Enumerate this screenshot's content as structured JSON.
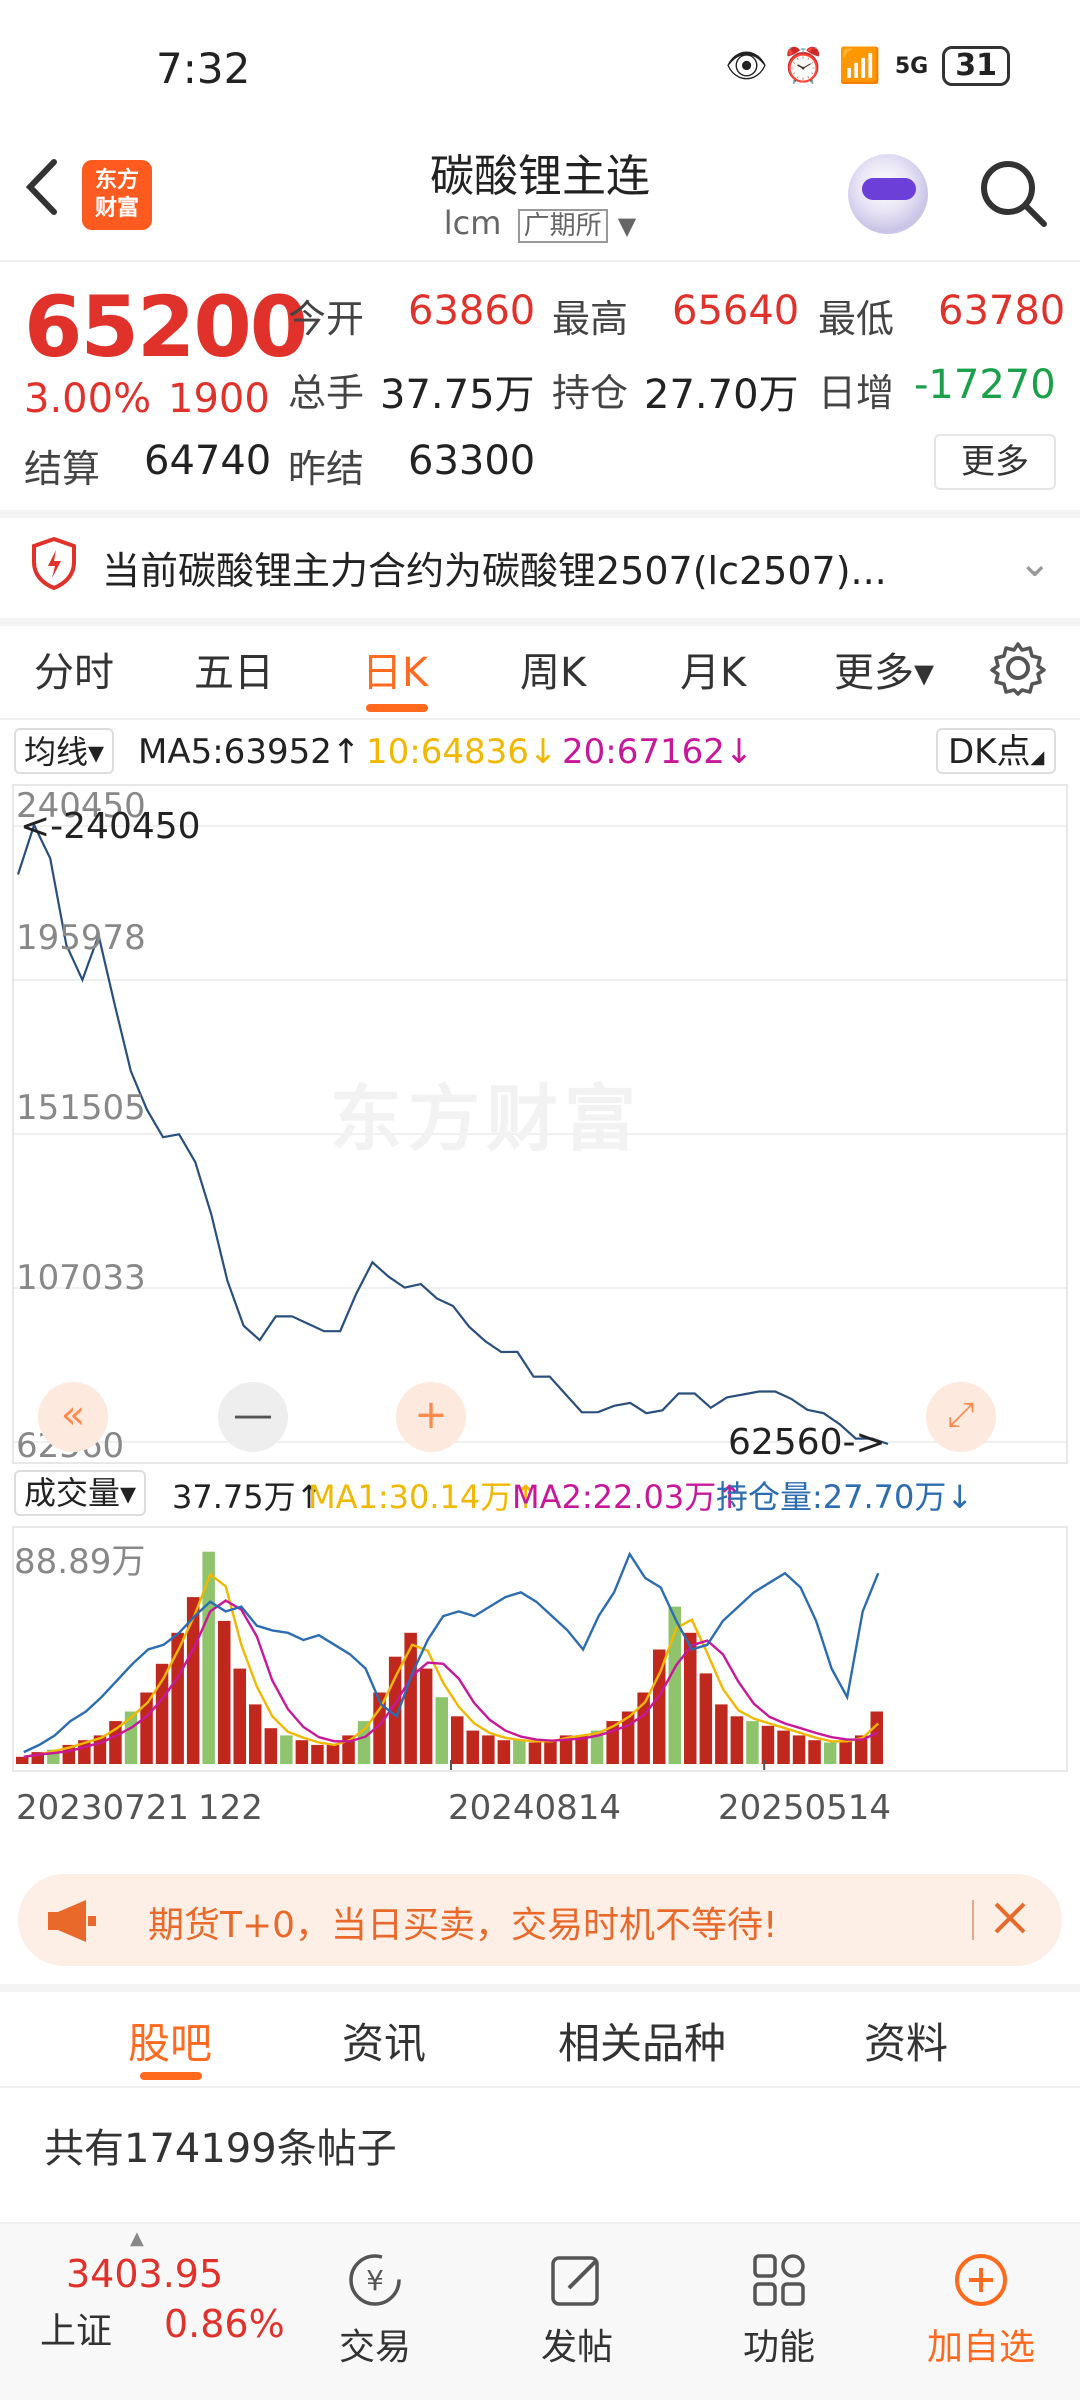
{
  "status_bar": {
    "time": "7:32",
    "battery": "31",
    "network": "5G"
  },
  "header": {
    "title": "碳酸锂主连",
    "code": "lcm",
    "exchange": "广期所",
    "logo_line1": "东方",
    "logo_line2": "财富"
  },
  "quote": {
    "price": "65200",
    "change_pct": "3.00%",
    "change_abs": "1900",
    "open_label": "今开",
    "open": "63860",
    "high_label": "最高",
    "high": "65640",
    "low_label": "最低",
    "low": "63780",
    "volume_label": "总手",
    "volume": "37.75万",
    "oi_label": "持仓",
    "oi": "27.70万",
    "daily_inc_label": "日增",
    "daily_inc": "-17270",
    "settle_label": "结算",
    "settle": "64740",
    "prev_settle_label": "昨结",
    "prev_settle": "63300",
    "more_label": "更多"
  },
  "notice": {
    "text": "当前碳酸锂主力合约为碳酸锂2507(lc2507)..."
  },
  "period_tabs": [
    "分时",
    "五日",
    "日K",
    "周K",
    "月K",
    "更多▾"
  ],
  "active_period": "日K",
  "ma_legend": {
    "selector": "均线▾",
    "ma5": "MA5:63952↑",
    "ma10": "10:64836↓",
    "ma20": "20:67162↓",
    "dk_label": "DK点",
    "colors": {
      "ma5": "#222222",
      "ma10": "#f0b800",
      "ma20": "#c8189a"
    }
  },
  "chart_labels": {
    "axis_ticks": [
      "240450",
      "195978",
      "151505",
      "107033",
      "62560"
    ],
    "max_annotation": "<-240450",
    "min_annotation": "62560->",
    "watermark": "东方财富"
  },
  "volume_legend": {
    "selector": "成交量▾",
    "vol": "37.75万↑",
    "ma1": "MA1:30.14万↑",
    "ma2": "MA2:22.03万↑",
    "oi": "持仓量:27.70万↓",
    "axis_max": "88.89万",
    "colors": {
      "ma1": "#f0b800",
      "ma2": "#c8189a",
      "oi": "#2c6cb0"
    }
  },
  "dates": [
    "20230721",
    "122",
    "20240814",
    "20250514"
  ],
  "banner": {
    "text": "期货T+0，当日买卖，交易时机不等待!"
  },
  "bottom_tabs": [
    "股吧",
    "资讯",
    "相关品种",
    "资料"
  ],
  "posts_count_text": "共有174199条帖子",
  "bottom_nav": {
    "index_value": "3403.95",
    "index_name": "上证",
    "index_change": "0.86%",
    "items": [
      "交易",
      "发帖",
      "功能",
      "加自选"
    ]
  },
  "chart_data": [
    {
      "type": "line",
      "title": "",
      "ylim": [
        62560,
        240450
      ],
      "x_range": [
        "20230721",
        "20250616"
      ],
      "x_ticks": [
        "20230721",
        "20240814",
        "20250514"
      ],
      "y_ticks": [
        62560,
        107033,
        151505,
        195978,
        240450
      ],
      "series": [
        {
          "values": [
            225000,
            240450,
            232000,
            205000,
            196000,
            210000,
            188000,
            170000,
            160000,
            150000,
            152000,
            142000,
            128000,
            110000,
            95000,
            92000,
            100000,
            98000,
            97000,
            96000,
            94000,
            106000,
            113000,
            110000,
            108000,
            107000,
            104000,
            103000,
            95000,
            92000,
            90000,
            88000,
            82000,
            80000,
            76000,
            72000,
            70000,
            73000,
            75000,
            70000,
            72000,
            78000,
            76000,
            73000,
            74000,
            76000,
            78000,
            76000,
            75000,
            73000,
            70000,
            68000,
            65000,
            63000,
            62560
          ]
        }
      ]
    },
    {
      "type": "bar",
      "title": "",
      "ylim": [
        0,
        88.89
      ],
      "series": [
        {
          "name": "成交量",
          "values": [
            3,
            5,
            6,
            8,
            10,
            12,
            18,
            22,
            30,
            42,
            55,
            70,
            89,
            60,
            40,
            25,
            15,
            12,
            10,
            8,
            8,
            12,
            18,
            30,
            45,
            55,
            40,
            28,
            20,
            14,
            12,
            10,
            10,
            9,
            10,
            12,
            12,
            14,
            18,
            22,
            30,
            48,
            66,
            55,
            38,
            25,
            20,
            18,
            16,
            14,
            12,
            10,
            9,
            10,
            12,
            22
          ]
        },
        {
          "name": "持仓量",
          "values": [
            5,
            8,
            12,
            18,
            22,
            28,
            35,
            42,
            48,
            50,
            55,
            62,
            68,
            64,
            66,
            58,
            56,
            55,
            52,
            54,
            50,
            46,
            40,
            25,
            20,
            38,
            52,
            62,
            64,
            62,
            66,
            70,
            72,
            68,
            62,
            56,
            48,
            62,
            72,
            88,
            78,
            74,
            60,
            48,
            50,
            60,
            66,
            72,
            76,
            80,
            74,
            60,
            40,
            28,
            64,
            80
          ]
        }
      ]
    }
  ]
}
